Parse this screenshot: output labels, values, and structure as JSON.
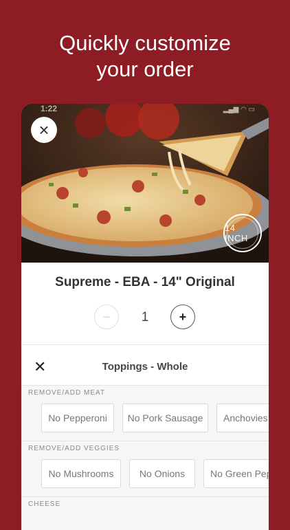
{
  "headline": {
    "line1": "Quickly customize",
    "line2": "your order"
  },
  "status": {
    "time": "1:22",
    "icons": "▂▄▆ ◠ ▭"
  },
  "product": {
    "title": "Supreme - EBA - 14\" Original",
    "size_badge": "14 INCH"
  },
  "quantity": {
    "value": "1",
    "minus": "−",
    "plus": "+"
  },
  "modal": {
    "close_glyph": "×",
    "sheet_close_glyph": "✕",
    "title": "Toppings - Whole"
  },
  "sections": [
    {
      "label": "REMOVE/ADD MEAT",
      "chips": [
        "No Pepperoni",
        "No Pork Sausage",
        "Anchovies"
      ]
    },
    {
      "label": "REMOVE/ADD VEGGIES",
      "chips": [
        "No Mushrooms",
        "No Onions",
        "No Green Peppers"
      ]
    },
    {
      "label": "CHEESE",
      "chips": []
    }
  ],
  "colors": {
    "background": "#8e1c24"
  }
}
